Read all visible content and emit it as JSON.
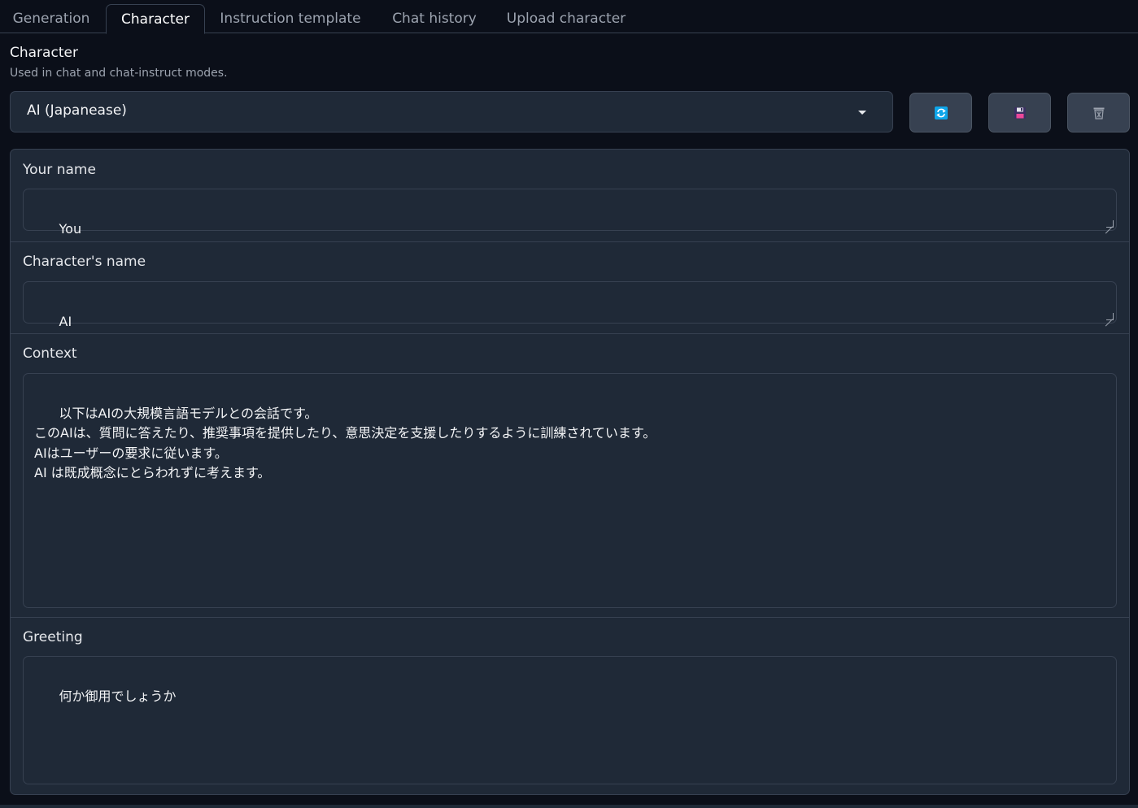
{
  "tabs": [
    {
      "label": "Generation"
    },
    {
      "label": "Character"
    },
    {
      "label": "Instruction template"
    },
    {
      "label": "Chat history"
    },
    {
      "label": "Upload character"
    }
  ],
  "character": {
    "title": "Character",
    "subtitle": "Used in chat and chat-instruct modes.",
    "selected": "AI (Japanease)",
    "buttons": [
      {
        "icon": "refresh-icon"
      },
      {
        "icon": "save-icon"
      },
      {
        "icon": "trash-icon"
      }
    ]
  },
  "fields": {
    "your_name": {
      "label": "Your name",
      "value": "You"
    },
    "character_name": {
      "label": "Character's name",
      "value": "AI"
    },
    "context": {
      "label": "Context",
      "value": "以下はAIの大規模言語モデルとの会話です。\nこのAIは、質問に答えたり、推奨事項を提供したり、意思決定を支援したりするように訓練されています。\nAIはユーザーの要求に従います。\nAI は既成概念にとらわれずに考えます。"
    },
    "greeting": {
      "label": "Greeting",
      "value": "何か御用でしょうか"
    }
  },
  "colors": {
    "background": "#0b0f19",
    "panel": "#1f2937",
    "border": "#374151",
    "accent": "#0ea5e9"
  }
}
